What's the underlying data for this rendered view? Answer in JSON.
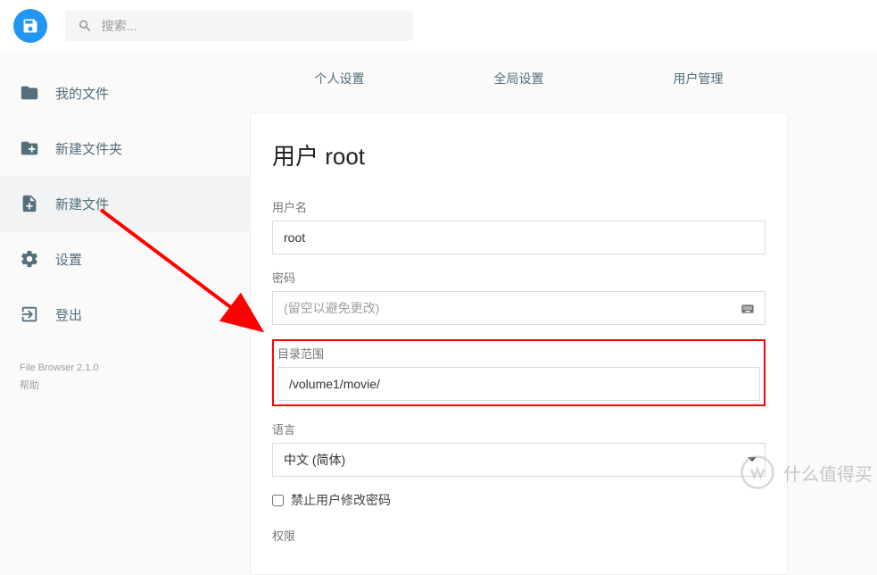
{
  "header": {
    "search_placeholder": "搜索..."
  },
  "sidebar": {
    "items": [
      {
        "label": "我的文件"
      },
      {
        "label": "新建文件夹"
      },
      {
        "label": "新建文件"
      },
      {
        "label": "设置"
      },
      {
        "label": "登出"
      }
    ],
    "footer": {
      "version": "File Browser 2.1.0",
      "help": "帮助"
    }
  },
  "tabs": [
    {
      "label": "个人设置"
    },
    {
      "label": "全局设置"
    },
    {
      "label": "用户管理"
    }
  ],
  "form": {
    "title": "用户 root",
    "username_label": "用户名",
    "username_value": "root",
    "password_label": "密码",
    "password_placeholder": "(留空以避免更改)",
    "scope_label": "目录范围",
    "scope_value": "/volume1/movie/",
    "language_label": "语言",
    "language_value": "中文 (简体)",
    "prevent_password_change": "禁止用户修改密码",
    "permissions_label": "权限"
  },
  "watermark": {
    "text": "什么值得买"
  }
}
